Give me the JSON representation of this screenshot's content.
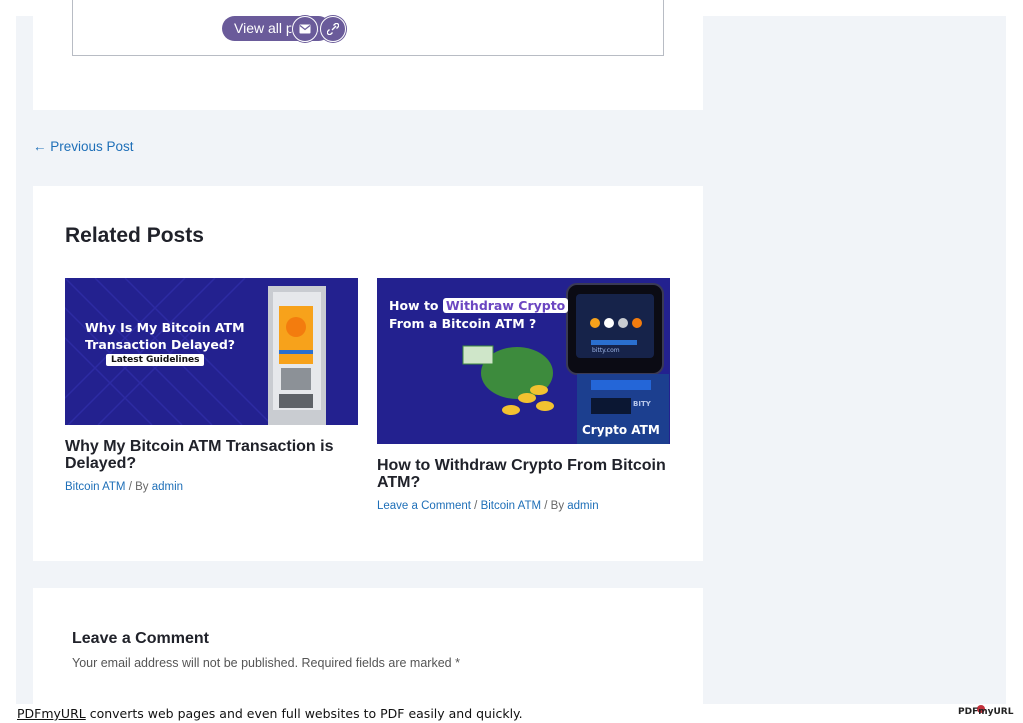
{
  "author_box": {
    "view_all_label": "View all posts",
    "icons": [
      "email-icon",
      "link-icon"
    ]
  },
  "navigation": {
    "previous_arrow": "←",
    "previous_label": "Previous Post"
  },
  "related": {
    "heading": "Related Posts",
    "posts": [
      {
        "image_lines": [
          "Why Is My Bitcoin ATM",
          "Transaction Delayed?"
        ],
        "image_badge": "Latest Guidelines",
        "title": "Why My Bitcoin ATM Transaction is Delayed?",
        "category": "Bitcoin ATM",
        "by": " / By ",
        "author": "admin"
      },
      {
        "image_line1_prefix": "How to ",
        "image_line1_highlight": "Withdraw Crypto",
        "image_line2": "From a Bitcoin ATM ?",
        "image_atm_label": "Crypto ATM",
        "image_atm_screen": "bitty.com",
        "image_atm_brand": "BITY",
        "title": "How to Withdraw Crypto From Bitcoin ATM?",
        "comment_link": "Leave a Comment",
        "sep": " / ",
        "category": "Bitcoin ATM",
        "by": " / By ",
        "author": "admin"
      }
    ]
  },
  "comment": {
    "heading": "Leave a Comment",
    "note": "Your email address will not be published. Required fields are marked *"
  },
  "footer": {
    "link": "PDFmyURL",
    "text": " converts web pages and even full websites to PDF easily and quickly.",
    "logo": "PDFmyURL"
  },
  "colors": {
    "accent": "#6a5b9a",
    "link": "#1e6fb8",
    "image_bg": "#23218f"
  }
}
